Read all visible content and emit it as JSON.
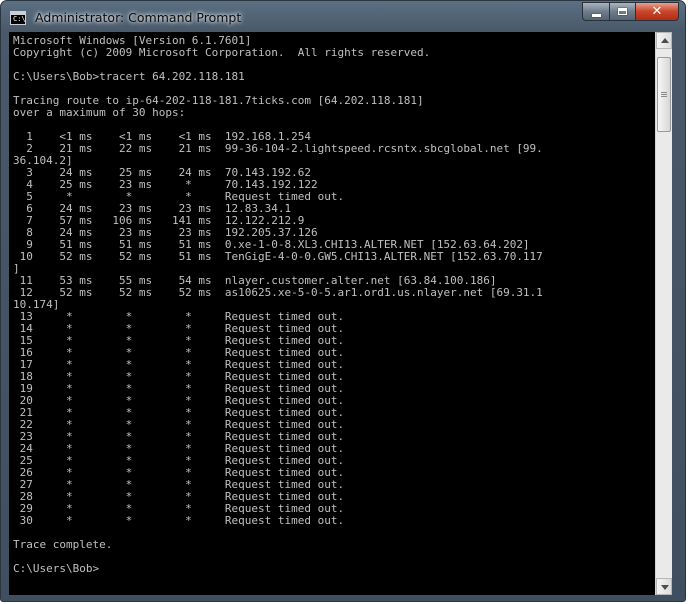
{
  "window": {
    "title": "Administrator: Command Prompt",
    "icon_glyph": "C:\\",
    "icon_name": "cmd-icon",
    "controls": {
      "minimize_icon": "minimize-icon",
      "maximize_icon": "maximize-icon",
      "close_glyph": "✕",
      "close_icon": "close-icon"
    }
  },
  "console": {
    "lines": [
      "Microsoft Windows [Version 6.1.7601]",
      "Copyright (c) 2009 Microsoft Corporation.  All rights reserved.",
      "",
      "C:\\Users\\Bob>tracert 64.202.118.181",
      "",
      "Tracing route to ip-64-202-118-181.7ticks.com [64.202.118.181]",
      "over a maximum of 30 hops:",
      "",
      "  1    <1 ms    <1 ms    <1 ms  192.168.1.254",
      "  2    21 ms    22 ms    21 ms  99-36-104-2.lightspeed.rcsntx.sbcglobal.net [99.",
      "36.104.2]",
      "  3    24 ms    25 ms    24 ms  70.143.192.62",
      "  4    25 ms    23 ms     *     70.143.192.122",
      "  5     *        *        *     Request timed out.",
      "  6    24 ms    23 ms    23 ms  12.83.34.1",
      "  7    57 ms   106 ms   141 ms  12.122.212.9",
      "  8    24 ms    23 ms    23 ms  192.205.37.126",
      "  9    51 ms    51 ms    51 ms  0.xe-1-0-8.XL3.CHI13.ALTER.NET [152.63.64.202]",
      " 10    52 ms    52 ms    51 ms  TenGigE-4-0-0.GW5.CHI13.ALTER.NET [152.63.70.117",
      "]",
      " 11    53 ms    55 ms    54 ms  nlayer.customer.alter.net [63.84.100.186]",
      " 12    52 ms    52 ms    52 ms  as10625.xe-5-0-5.ar1.ord1.us.nlayer.net [69.31.1",
      "10.174]",
      " 13     *        *        *     Request timed out.",
      " 14     *        *        *     Request timed out.",
      " 15     *        *        *     Request timed out.",
      " 16     *        *        *     Request timed out.",
      " 17     *        *        *     Request timed out.",
      " 18     *        *        *     Request timed out.",
      " 19     *        *        *     Request timed out.",
      " 20     *        *        *     Request timed out.",
      " 21     *        *        *     Request timed out.",
      " 22     *        *        *     Request timed out.",
      " 23     *        *        *     Request timed out.",
      " 24     *        *        *     Request timed out.",
      " 25     *        *        *     Request timed out.",
      " 26     *        *        *     Request timed out.",
      " 27     *        *        *     Request timed out.",
      " 28     *        *        *     Request timed out.",
      " 29     *        *        *     Request timed out.",
      " 30     *        *        *     Request timed out.",
      "",
      "Trace complete.",
      "",
      "C:\\Users\\Bob>"
    ]
  },
  "colors": {
    "console_background": "#000000",
    "console_text": "#c0c0c0",
    "close_button": "#c9452a"
  },
  "scrollbar": {
    "up_icon": "arrow-up-icon",
    "down_icon": "arrow-down-icon"
  }
}
